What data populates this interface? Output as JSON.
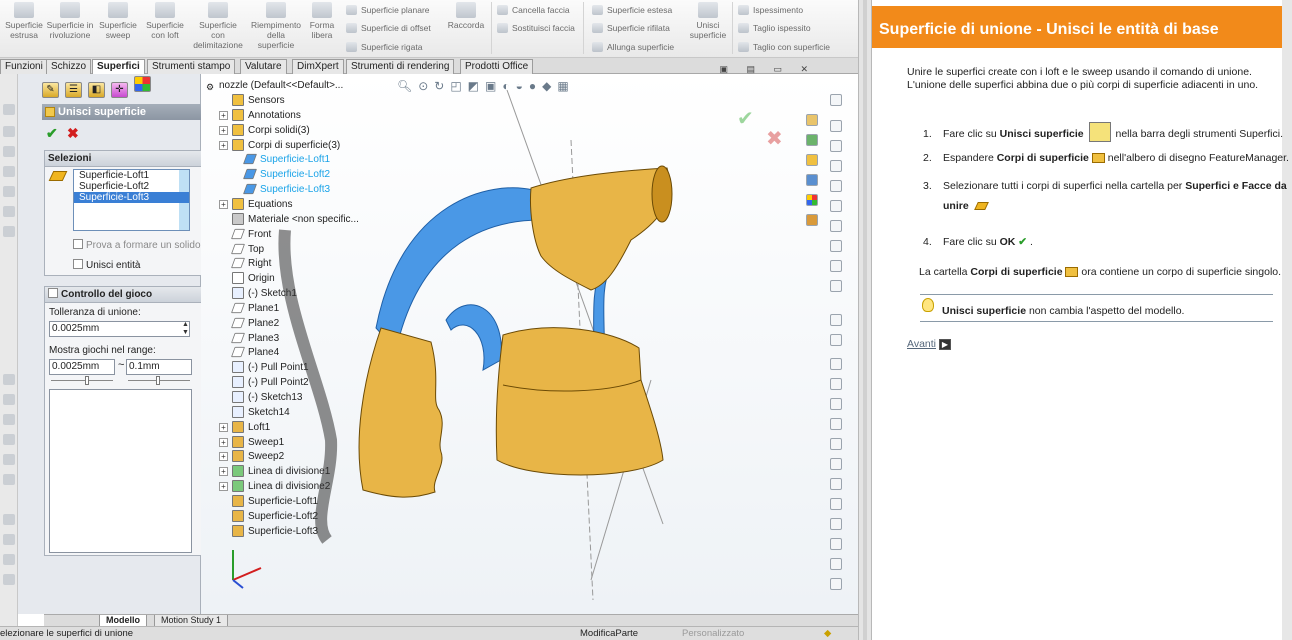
{
  "ribbon": {
    "buttons": [
      "Superficie estrusa",
      "Superficie in rivoluzione",
      "Superficie sweep",
      "Superficie con loft",
      "Superficie con delimitazione",
      "Riempimento della superficie",
      "Forma libera",
      "Raccorda",
      "Unisci superficie"
    ],
    "small_col1": [
      "Superficie planare",
      "Superficie di offset",
      "Superficie rigata"
    ],
    "small_col2": [
      "Cancella faccia",
      "Sostituisci faccia"
    ],
    "small_col3": [
      "Superficie estesa",
      "Superficie rifilata",
      "Allunga superficie"
    ],
    "small_col4": [
      "Ispessimento",
      "Taglio ispessito",
      "Taglio con superficie"
    ]
  },
  "tabs": [
    "Funzioni",
    "Schizzo",
    "Superfici",
    "Strumenti stampo",
    "Valutare",
    "DimXpert",
    "Strumenti di rendering",
    "Prodotti Office"
  ],
  "active_tab": "Superfici",
  "property_manager": {
    "title": "Unisci superficie",
    "ok_icon": "checkmark-icon",
    "cancel_icon": "close-icon",
    "selections": {
      "header": "Selezioni",
      "items": [
        "Superficie-Loft1",
        "Superficie-Loft2",
        "Superficie-Loft3"
      ],
      "selected_item": "Superficie-Loft3",
      "try_solid_label": "Prova a formare un solido",
      "merge_entities_label": "Unisci entità"
    },
    "gap_control": {
      "header": "Controllo del gioco",
      "tolerance_label": "Tolleranza di unione:",
      "tolerance_value": "0.0025mm",
      "range_label": "Mostra giochi nel range:",
      "range_min": "0.0025mm",
      "range_sep": "~",
      "range_max": "0.1mm"
    }
  },
  "tree": {
    "root": "nozzle  (Default<<Default>...",
    "items": [
      {
        "label": "Sensors",
        "icon": "sensor-icon",
        "expand": false,
        "indent": 1
      },
      {
        "label": "Annotations",
        "icon": "annotation-icon",
        "expand": true,
        "indent": 1
      },
      {
        "label": "Corpi solidi(3)",
        "icon": "solid-bodies-icon",
        "expand": true,
        "indent": 1
      },
      {
        "label": "Corpi di superficie(3)",
        "icon": "surface-bodies-icon",
        "expand": true,
        "indent": 1
      },
      {
        "label": "Superficie-Loft1",
        "icon": "surface-icon",
        "expand": false,
        "indent": 2,
        "highlight": true
      },
      {
        "label": "Superficie-Loft2",
        "icon": "surface-icon",
        "expand": false,
        "indent": 2,
        "highlight": true
      },
      {
        "label": "Superficie-Loft3",
        "icon": "surface-icon",
        "expand": false,
        "indent": 2,
        "highlight": true
      },
      {
        "label": "Equations",
        "icon": "equation-icon",
        "expand": true,
        "indent": 1
      },
      {
        "label": "Materiale <non specific...",
        "icon": "material-icon",
        "expand": false,
        "indent": 1
      },
      {
        "label": "Front",
        "icon": "plane-icon",
        "expand": false,
        "indent": 1
      },
      {
        "label": "Top",
        "icon": "plane-icon",
        "expand": false,
        "indent": 1
      },
      {
        "label": "Right",
        "icon": "plane-icon",
        "expand": false,
        "indent": 1
      },
      {
        "label": "Origin",
        "icon": "origin-icon",
        "expand": false,
        "indent": 1
      },
      {
        "label": "(-) Sketch1",
        "icon": "sketch-icon",
        "expand": false,
        "indent": 1
      },
      {
        "label": "Plane1",
        "icon": "plane-icon",
        "expand": false,
        "indent": 1
      },
      {
        "label": "Plane2",
        "icon": "plane-icon",
        "expand": false,
        "indent": 1
      },
      {
        "label": "Plane3",
        "icon": "plane-icon",
        "expand": false,
        "indent": 1
      },
      {
        "label": "Plane4",
        "icon": "plane-icon",
        "expand": false,
        "indent": 1
      },
      {
        "label": "(-) Pull Point1",
        "icon": "sketch-icon",
        "expand": false,
        "indent": 1
      },
      {
        "label": "(-) Pull Point2",
        "icon": "sketch-icon",
        "expand": false,
        "indent": 1
      },
      {
        "label": "(-) Sketch13",
        "icon": "sketch-icon",
        "expand": false,
        "indent": 1
      },
      {
        "label": "Sketch14",
        "icon": "sketch-icon",
        "expand": false,
        "indent": 1
      },
      {
        "label": "Loft1",
        "icon": "loft-icon",
        "expand": true,
        "indent": 1
      },
      {
        "label": "Sweep1",
        "icon": "sweep-icon",
        "expand": true,
        "indent": 1
      },
      {
        "label": "Sweep2",
        "icon": "sweep-icon",
        "expand": true,
        "indent": 1
      },
      {
        "label": "Linea di divisione1",
        "icon": "split-line-icon",
        "expand": true,
        "indent": 1
      },
      {
        "label": "Linea di divisione2",
        "icon": "split-line-icon",
        "expand": true,
        "indent": 1
      },
      {
        "label": "Superficie-Loft1",
        "icon": "surface-loft-icon",
        "expand": false,
        "indent": 1
      },
      {
        "label": "Superficie-Loft2",
        "icon": "surface-loft-icon",
        "expand": false,
        "indent": 1
      },
      {
        "label": "Superficie-Loft3",
        "icon": "surface-loft-icon",
        "expand": false,
        "indent": 1
      }
    ]
  },
  "bottom_tabs": [
    "Modello",
    "Motion Study 1"
  ],
  "status": {
    "left": "elezionare le superfici di unione",
    "mid": "ModificaParte",
    "right": "Personalizzato"
  },
  "help": {
    "title": "Superficie di unione - Unisci le entità di base",
    "intro": [
      "Unire le superfici create con i loft e le sweep usando il comando di unione.",
      "L'unione delle superfici abbina due o più corpi di superficie adiacenti in uno."
    ],
    "steps": [
      {
        "n": "1.",
        "pre": "Fare clic su ",
        "bold": "Unisci superficie",
        "post": " nella barra degli strumenti Superfici."
      },
      {
        "n": "2.",
        "pre": "Espandere ",
        "bold": "Corpi di superficie",
        "post": " nell'albero di disegno FeatureManager."
      },
      {
        "n": "3.",
        "pre": "Selezionare tutti i corpi di superfici nella cartella per ",
        "bold": "Superfici e Facce da",
        "post": ""
      },
      {
        "n": "",
        "pre": "",
        "bold": "unire",
        "post": ""
      },
      {
        "n": "4.",
        "pre": "Fare clic su ",
        "bold": "OK",
        "post": " ."
      }
    ],
    "result_pre": "La cartella ",
    "result_bold": "Corpi di superficie",
    "result_post": " ora contiene un corpo di superficie singolo.",
    "note_bold": "Unisci superficie",
    "note_rest": " non cambia l'aspetto del modello.",
    "next_link": "Avanti"
  },
  "colors": {
    "accent": "#f28a1a",
    "surface": "#2f8fe0",
    "body": "#e8b547",
    "selection": "#3a7fd5"
  }
}
